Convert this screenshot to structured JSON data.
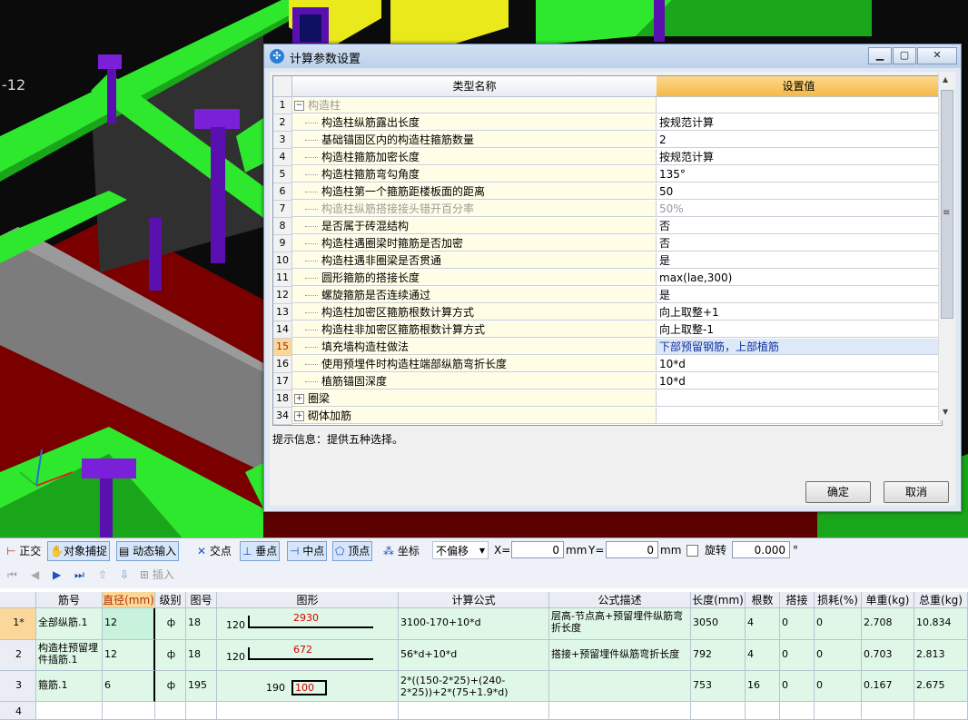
{
  "viewport": {
    "axis_label": "-12"
  },
  "dialog": {
    "title": "计算参数设置",
    "min_label": "▁",
    "max_label": "▢",
    "close_label": "✕",
    "columns": {
      "name": "类型名称",
      "value": "设置值"
    },
    "rows": [
      {
        "num": "1",
        "name": "构造柱",
        "value": "",
        "group": true,
        "expander": "−",
        "disabled": true
      },
      {
        "num": "2",
        "name": "构造柱纵筋露出长度",
        "value": "按规范计算"
      },
      {
        "num": "3",
        "name": "基础锚固区内的构造柱箍筋数量",
        "value": "2"
      },
      {
        "num": "4",
        "name": "构造柱箍筋加密长度",
        "value": "按规范计算"
      },
      {
        "num": "5",
        "name": "构造柱箍筋弯勾角度",
        "value": "135°"
      },
      {
        "num": "6",
        "name": "构造柱第一个箍筋距楼板面的距离",
        "value": "50"
      },
      {
        "num": "7",
        "name": "构造柱纵筋搭接接头错开百分率",
        "value": "50%",
        "disabled": true
      },
      {
        "num": "8",
        "name": "是否属于砖混结构",
        "value": "否"
      },
      {
        "num": "9",
        "name": "构造柱遇圈梁时箍筋是否加密",
        "value": "否"
      },
      {
        "num": "10",
        "name": "构造柱遇非圈梁是否贯通",
        "value": "是"
      },
      {
        "num": "11",
        "name": "圆形箍筋的搭接长度",
        "value": "max(lae,300)"
      },
      {
        "num": "12",
        "name": "螺旋箍筋是否连续通过",
        "value": "是"
      },
      {
        "num": "13",
        "name": "构造柱加密区箍筋根数计算方式",
        "value": "向上取整+1"
      },
      {
        "num": "14",
        "name": "构造柱非加密区箍筋根数计算方式",
        "value": "向上取整-1"
      },
      {
        "num": "15",
        "name": "填充墙构造柱做法",
        "value": "下部预留钢筋，上部植筋",
        "selected": true
      },
      {
        "num": "16",
        "name": "使用预埋件时构造柱端部纵筋弯折长度",
        "value": "10*d"
      },
      {
        "num": "17",
        "name": "植筋锚固深度",
        "value": "10*d"
      },
      {
        "num": "18",
        "name": "圈梁",
        "value": "",
        "group": true,
        "expander": "+"
      },
      {
        "num": "34",
        "name": "砌体加筋",
        "value": "",
        "group": true,
        "expander": "+"
      }
    ],
    "hint": "提示信息：提供五种选择。",
    "ok_label": "确定",
    "cancel_label": "取消"
  },
  "snapbar": {
    "ortho": "正交",
    "snap": "对象捕捉",
    "dyn_input": "动态输入",
    "intersect": "交点",
    "perp": "垂点",
    "mid": "中点",
    "vertex": "顶点",
    "coord": "坐标",
    "offset_mode": "不偏移",
    "x_label": "X=",
    "x_value": "0",
    "x_unit": "mm",
    "y_label": "Y=",
    "y_value": "0",
    "y_unit": "mm",
    "rotate_label": "旋转",
    "rotate_value": "0.000",
    "rotate_unit": "°"
  },
  "navbar": {
    "insert": "插入"
  },
  "rebar": {
    "headers": [
      "筋号",
      "直径(mm)",
      "级别",
      "图号",
      "图形",
      "计算公式",
      "公式描述",
      "长度(mm)",
      "根数",
      "搭接",
      "损耗(%)",
      "单重(kg)",
      "总重(kg)"
    ],
    "rows": [
      {
        "num": "1*",
        "name": "全部纵筋.1",
        "dia": "12",
        "grade": "ф",
        "fig": "18",
        "shape_left": "120",
        "shape_mid": "2930",
        "formula": "3100-170+10*d",
        "desc": "层高-节点高+预留埋件纵筋弯折长度",
        "length": "3050",
        "count": "4",
        "lap": "0",
        "loss": "0",
        "unit_wt": "2.708",
        "total_wt": "10.834"
      },
      {
        "num": "2",
        "name": "构造柱预留埋件插筋.1",
        "dia": "12",
        "grade": "ф",
        "fig": "18",
        "shape_left": "120",
        "shape_mid": "672",
        "formula": "56*d+10*d",
        "desc": "搭接+预留埋件纵筋弯折长度",
        "length": "792",
        "count": "4",
        "lap": "0",
        "loss": "0",
        "unit_wt": "0.703",
        "total_wt": "2.813"
      },
      {
        "num": "3",
        "name": "箍筋.1",
        "dia": "6",
        "grade": "ф",
        "fig": "195",
        "shape_left": "190",
        "shape_mid": "100",
        "formula": "2*((150-2*25)+(240-2*25))+2*(75+1.9*d)",
        "desc": "",
        "length": "753",
        "count": "16",
        "lap": "0",
        "loss": "0",
        "unit_wt": "0.167",
        "total_wt": "2.675"
      },
      {
        "num": "4",
        "name": "",
        "dia": "",
        "grade": "",
        "fig": "",
        "shape_left": "",
        "shape_mid": "",
        "formula": "",
        "desc": "",
        "length": "",
        "count": "",
        "lap": "",
        "loss": "",
        "unit_wt": "",
        "total_wt": ""
      }
    ]
  }
}
